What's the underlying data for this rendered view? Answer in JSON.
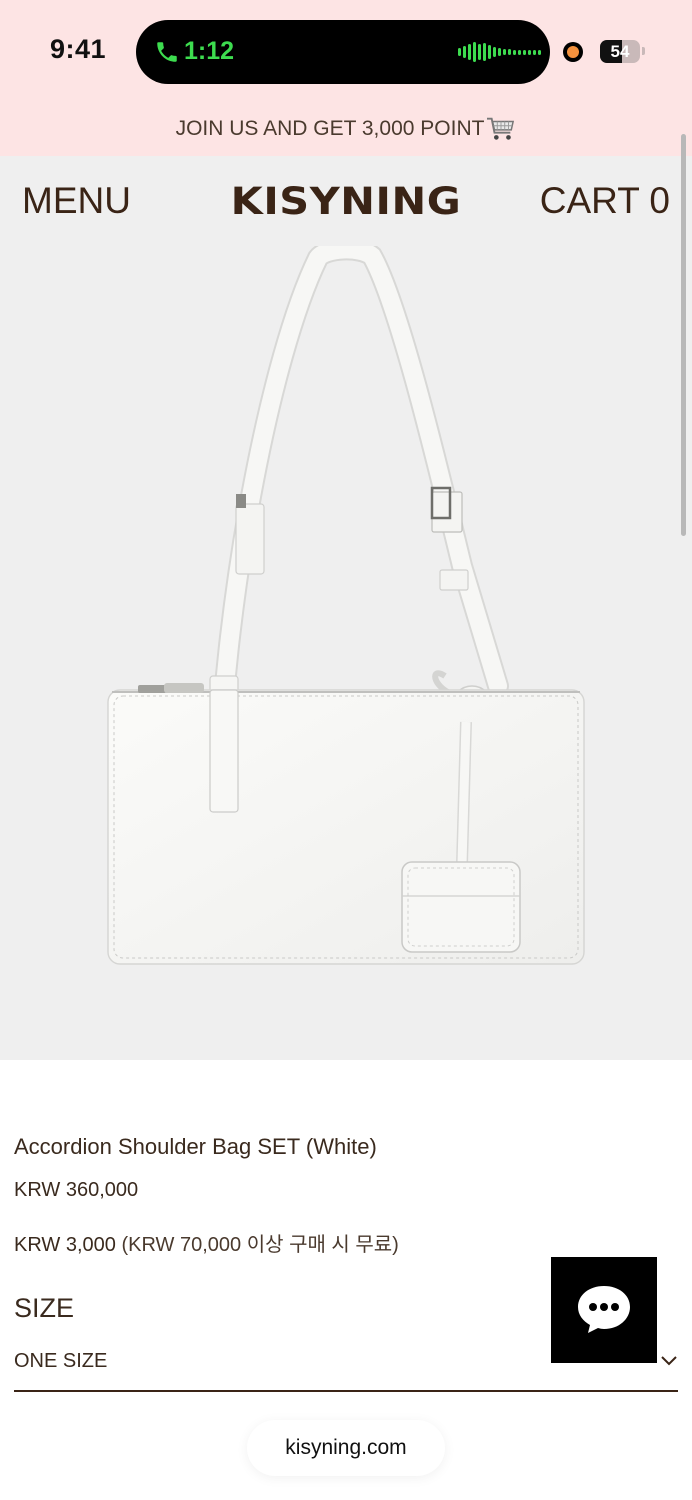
{
  "status_bar": {
    "time": "9:41",
    "call_time": "1:12",
    "battery": "54",
    "battery_level_percent": 54,
    "call_color": "#3ddc4f",
    "indicator_color": "#f5923e"
  },
  "promo": {
    "text": "JOIN US AND GET 3,000 POINT",
    "icon": "shopping-cart-icon"
  },
  "header": {
    "menu_label": "MENU",
    "brand": "KISYNING",
    "cart_label": "CART 0"
  },
  "product": {
    "image_alt": "product-photo",
    "name": "Accordion Shoulder Bag SET (White)",
    "price": "KRW 360,000",
    "shipping_fee": "KRW 3,000",
    "shipping_note": "(KRW 70,000 이상 구매 시 무료)",
    "size_label": "SIZE",
    "size_value": "ONE SIZE"
  },
  "chat": {
    "icon": "chat-bubble-icon"
  },
  "browser": {
    "url": "kisyning.com"
  },
  "colors": {
    "banner_bg": "#fde4e4",
    "header_bg": "#efefef",
    "text_brown": "#3a2416"
  }
}
